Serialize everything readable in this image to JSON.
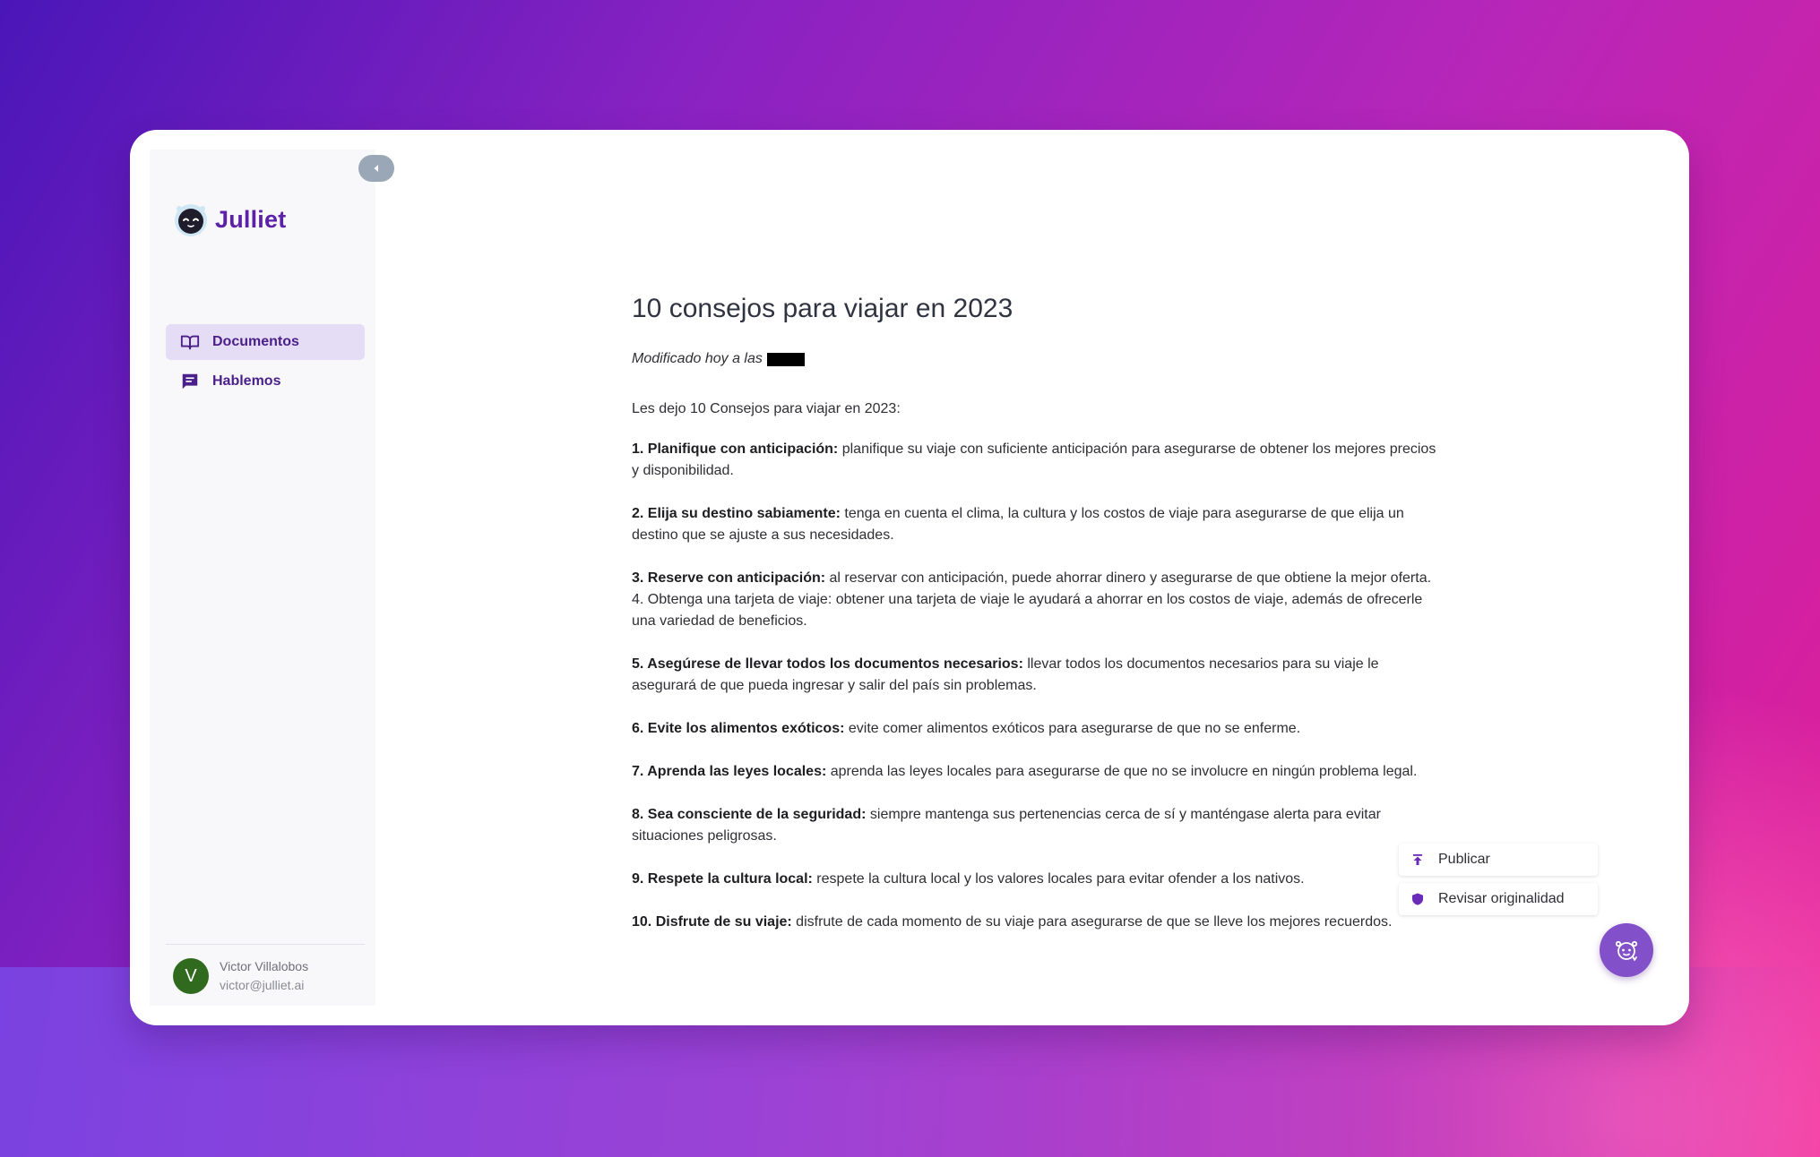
{
  "app": {
    "name": "Julliet"
  },
  "sidebar": {
    "items": [
      {
        "label": "Documentos",
        "icon": "book-icon",
        "active": true
      },
      {
        "label": "Hablemos",
        "icon": "chat-icon",
        "active": false
      }
    ]
  },
  "user": {
    "initial": "V",
    "name": "Victor Villalobos",
    "email": "victor@julliet.ai"
  },
  "document": {
    "title": "10 consejos para viajar en 2023",
    "modified_label": "Modificado hoy a las",
    "intro": "Les dejo 10 Consejos para viajar en 2023:",
    "tips": [
      {
        "heading": "1. Planifique con anticipación:",
        "text": " planifique su viaje con suficiente anticipación para asegurarse de obtener los mejores precios y disponibilidad."
      },
      {
        "heading": "2. Elija su destino sabiamente:",
        "text": " tenga en cuenta el clima, la cultura y los costos de viaje para asegurarse de que elija un destino que se ajuste a sus necesidades."
      },
      {
        "heading": "3. Reserve con anticipación:",
        "text": " al  reservar con anticipación, puede ahorrar dinero y asegurarse de que obtiene la mejor oferta. 4. Obtenga una tarjeta de viaje: obtener una tarjeta de viaje le ayudará a ahorrar en los costos de viaje, además de ofrecerle una variedad de beneficios."
      },
      {
        "heading": "5. Asegúrese de llevar todos los documentos necesarios:",
        "text": " llevar todos los documentos necesarios para su viaje le asegurará de que pueda ingresar y salir del país sin problemas."
      },
      {
        "heading": "6. Evite los alimentos exóticos:",
        "text": " evite comer alimentos exóticos para asegurarse de que no se enferme."
      },
      {
        "heading": "7. Aprenda las leyes locales:",
        "text": " aprenda las leyes locales para asegurarse de que no se involucre en ningún problema legal."
      },
      {
        "heading": "8. Sea consciente de la seguridad:",
        "text": " siempre mantenga sus pertenencias cerca de sí y manténgase alerta para evitar situaciones peligrosas."
      },
      {
        "heading": "9. Respete la cultura local:",
        "text": " respete la cultura local y los valores locales para evitar ofender a los nativos."
      },
      {
        "heading": "10. Disfrute de su viaje:",
        "text": " disfrute de cada momento de su viaje para asegurarse de que se lleve los mejores recuerdos."
      }
    ]
  },
  "actions": {
    "publish": {
      "label": "Publicar",
      "icon": "upload-icon"
    },
    "originality": {
      "label": "Revisar originalidad",
      "icon": "shield-icon"
    }
  },
  "assistant_button": {
    "icon": "robot-icon"
  },
  "colors": {
    "brand": "#5b22a8",
    "nav_active_bg": "#e5dcf5",
    "avatar_bg": "#2f6a1e",
    "fab_bg": "#8250c9"
  }
}
